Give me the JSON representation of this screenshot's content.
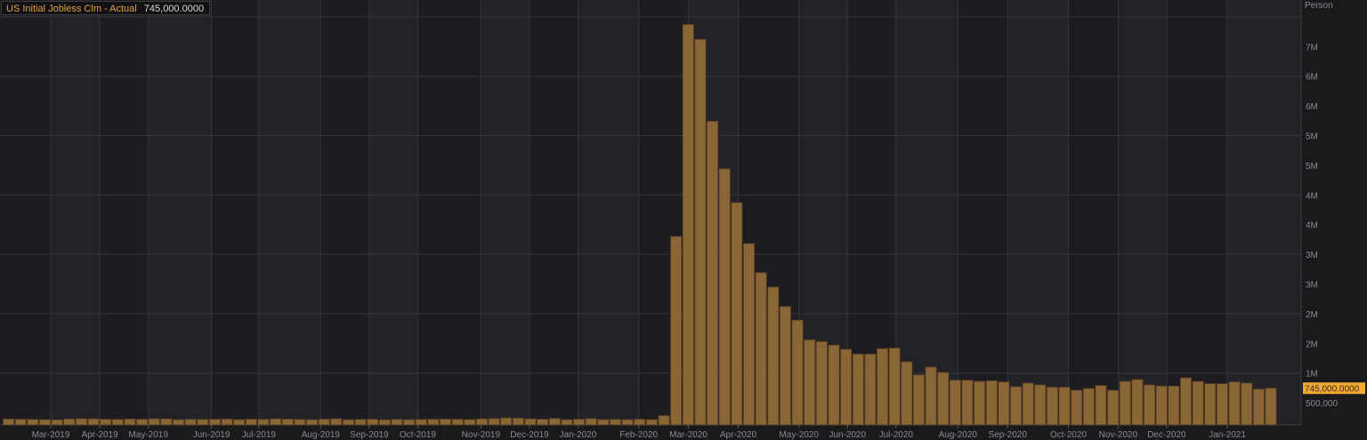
{
  "chart_data": {
    "type": "bar",
    "title": "US Initial Jobless Clm - Actual",
    "current_value_label": "745,000.0000",
    "current_value": 745000,
    "y_unit_label": "Person",
    "ylim": [
      0,
      7300000
    ],
    "y_ticks": [
      {
        "value": 500000,
        "label": "500,000"
      },
      {
        "value": 1000000,
        "label": "1M"
      },
      {
        "value": 1500000,
        "label": "2M"
      },
      {
        "value": 2000000,
        "label": "2M"
      },
      {
        "value": 2500000,
        "label": "3M"
      },
      {
        "value": 3000000,
        "label": "3M"
      },
      {
        "value": 3500000,
        "label": "4M"
      },
      {
        "value": 4000000,
        "label": "4M"
      },
      {
        "value": 4500000,
        "label": "5M"
      },
      {
        "value": 5000000,
        "label": "5M"
      },
      {
        "value": 5500000,
        "label": "6M"
      },
      {
        "value": 6000000,
        "label": "6M"
      },
      {
        "value": 6500000,
        "label": "7M"
      }
    ],
    "grid": true,
    "x_ticks": [
      {
        "index": 3.96,
        "label": "Mar-2019"
      },
      {
        "index": 8.0,
        "label": "Apr-2019"
      },
      {
        "index": 12.0,
        "label": "May-2019"
      },
      {
        "index": 17.2,
        "label": "Jun-2019"
      },
      {
        "index": 21.1,
        "label": "Jul-2019"
      },
      {
        "index": 26.2,
        "label": "Aug-2019"
      },
      {
        "index": 30.2,
        "label": "Sep-2019"
      },
      {
        "index": 34.2,
        "label": "Oct-2019"
      },
      {
        "index": 39.4,
        "label": "Nov-2019"
      },
      {
        "index": 43.4,
        "label": "Dec-2019"
      },
      {
        "index": 47.4,
        "label": "Jan-2020"
      },
      {
        "index": 52.4,
        "label": "Feb-2020"
      },
      {
        "index": 56.5,
        "label": "Mar-2020"
      },
      {
        "index": 60.6,
        "label": "Apr-2020"
      },
      {
        "index": 65.6,
        "label": "May-2020"
      },
      {
        "index": 69.6,
        "label": "Jun-2020"
      },
      {
        "index": 73.6,
        "label": "Jul-2020"
      },
      {
        "index": 78.7,
        "label": "Aug-2020"
      },
      {
        "index": 82.8,
        "label": "Sep-2020"
      },
      {
        "index": 87.8,
        "label": "Oct-2020"
      },
      {
        "index": 91.9,
        "label": "Nov-2020"
      },
      {
        "index": 95.9,
        "label": "Dec-2020"
      },
      {
        "index": 100.9,
        "label": "Jan-2021"
      }
    ],
    "values": [
      225000,
      222000,
      220000,
      216000,
      212000,
      225000,
      230000,
      228000,
      222000,
      218000,
      225000,
      222000,
      230000,
      228000,
      215000,
      220000,
      218000,
      222000,
      225000,
      216000,
      222000,
      220000,
      228000,
      224000,
      218000,
      215000,
      222000,
      230000,
      214000,
      218000,
      222000,
      212000,
      220000,
      214000,
      218000,
      222000,
      224000,
      220000,
      216000,
      228000,
      232000,
      245000,
      240000,
      228000,
      222000,
      235000,
      214000,
      222000,
      232000,
      215000,
      218000,
      215000,
      222000,
      216000,
      282000,
      3300000,
      6870000,
      6620000,
      5240000,
      4440000,
      3870000,
      3180000,
      2690000,
      2450000,
      2120000,
      1890000,
      1560000,
      1530000,
      1470000,
      1400000,
      1320000,
      1320000,
      1410000,
      1420000,
      1190000,
      970000,
      1100000,
      1010000,
      880000,
      880000,
      860000,
      870000,
      850000,
      770000,
      830000,
      800000,
      760000,
      760000,
      710000,
      740000,
      790000,
      710000,
      860000,
      890000,
      800000,
      780000,
      780000,
      920000,
      860000,
      820000,
      820000,
      850000,
      830000,
      730000,
      745000
    ]
  },
  "colors": {
    "bar": "#8a6536",
    "bar_edge": "#5e4322",
    "plot_bg": "#1d1d21",
    "band_bg": "#232327",
    "grid": "#34343a",
    "axis_text": "#8a8a90",
    "tag_bg": "#f2a934",
    "tag_text": "#3a2a10",
    "title": "#e0a040"
  }
}
